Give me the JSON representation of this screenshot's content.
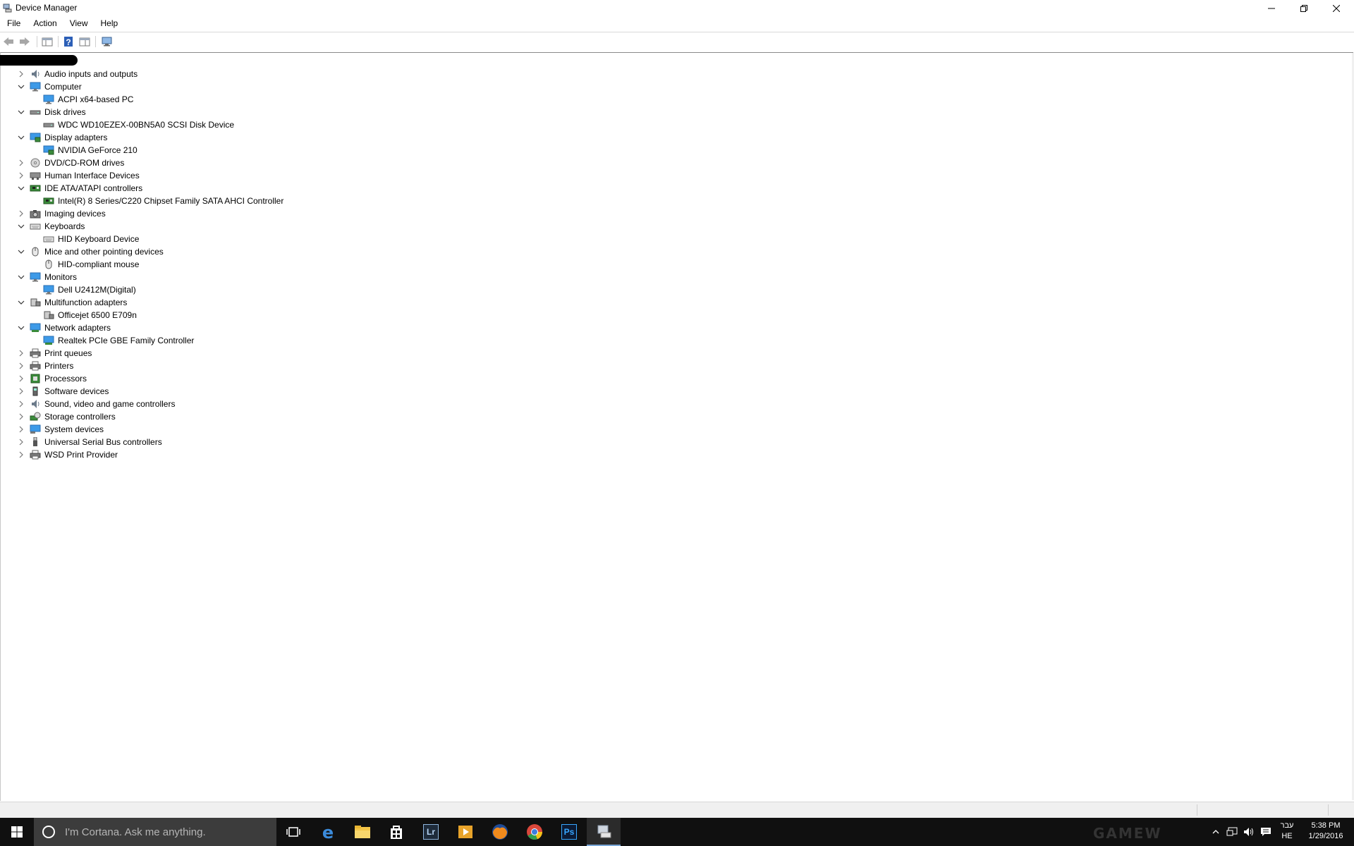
{
  "window": {
    "title": "Device Manager"
  },
  "menu": [
    "File",
    "Action",
    "View",
    "Help"
  ],
  "tree": [
    {
      "label": "Audio inputs and outputs",
      "expanded": false,
      "icon": "speaker-icon",
      "children": []
    },
    {
      "label": "Computer",
      "expanded": true,
      "icon": "monitor-icon",
      "children": [
        {
          "label": "ACPI x64-based PC",
          "icon": "monitor-icon"
        }
      ]
    },
    {
      "label": "Disk drives",
      "expanded": true,
      "icon": "disk-drive-icon",
      "children": [
        {
          "label": "WDC WD10EZEX-00BN5A0 SCSI Disk Device",
          "icon": "disk-drive-icon"
        }
      ]
    },
    {
      "label": "Display adapters",
      "expanded": true,
      "icon": "display-adapter-icon",
      "children": [
        {
          "label": "NVIDIA GeForce 210",
          "icon": "display-adapter-icon"
        }
      ]
    },
    {
      "label": "DVD/CD-ROM drives",
      "expanded": false,
      "icon": "dvd-icon",
      "children": []
    },
    {
      "label": "Human Interface Devices",
      "expanded": false,
      "icon": "hid-icon",
      "children": []
    },
    {
      "label": "IDE ATA/ATAPI controllers",
      "expanded": true,
      "icon": "controller-card-icon",
      "children": [
        {
          "label": "Intel(R) 8 Series/C220 Chipset Family SATA AHCI Controller",
          "icon": "controller-card-icon"
        }
      ]
    },
    {
      "label": "Imaging devices",
      "expanded": false,
      "icon": "camera-icon",
      "children": []
    },
    {
      "label": "Keyboards",
      "expanded": true,
      "icon": "keyboard-icon",
      "children": [
        {
          "label": "HID Keyboard Device",
          "icon": "keyboard-icon"
        }
      ]
    },
    {
      "label": "Mice and other pointing devices",
      "expanded": true,
      "icon": "mouse-icon",
      "children": [
        {
          "label": "HID-compliant mouse",
          "icon": "mouse-icon"
        }
      ]
    },
    {
      "label": "Monitors",
      "expanded": true,
      "icon": "monitor-icon",
      "children": [
        {
          "label": "Dell U2412M(Digital)",
          "icon": "monitor-icon"
        }
      ]
    },
    {
      "label": "Multifunction adapters",
      "expanded": true,
      "icon": "multifunction-icon",
      "children": [
        {
          "label": "Officejet 6500 E709n",
          "icon": "multifunction-icon"
        }
      ]
    },
    {
      "label": "Network adapters",
      "expanded": true,
      "icon": "network-adapter-icon",
      "children": [
        {
          "label": "Realtek PCIe GBE Family Controller",
          "icon": "network-adapter-icon"
        }
      ]
    },
    {
      "label": "Print queues",
      "expanded": false,
      "icon": "printer-icon",
      "children": []
    },
    {
      "label": "Printers",
      "expanded": false,
      "icon": "printer-icon",
      "children": []
    },
    {
      "label": "Processors",
      "expanded": false,
      "icon": "processor-icon",
      "children": []
    },
    {
      "label": "Software devices",
      "expanded": false,
      "icon": "software-device-icon",
      "children": []
    },
    {
      "label": "Sound, video and game controllers",
      "expanded": false,
      "icon": "speaker-icon",
      "children": []
    },
    {
      "label": "Storage controllers",
      "expanded": false,
      "icon": "storage-controller-icon",
      "children": []
    },
    {
      "label": "System devices",
      "expanded": false,
      "icon": "system-devices-icon",
      "children": []
    },
    {
      "label": "Universal Serial Bus controllers",
      "expanded": false,
      "icon": "usb-icon",
      "children": []
    },
    {
      "label": "WSD Print Provider",
      "expanded": false,
      "icon": "printer-icon",
      "children": []
    }
  ],
  "taskbar": {
    "search_placeholder": "I'm Cortana. Ask me anything.",
    "apps": [
      "task-view-icon",
      "edge-icon",
      "file-explorer-icon",
      "store-icon",
      "lightroom-icon",
      "media-player-icon",
      "firefox-icon",
      "chrome-icon",
      "photoshop-icon",
      "device-manager-icon"
    ],
    "lightroom_label": "Lr",
    "photoshop_label": "Ps",
    "lang_top": "עבר",
    "lang_bottom": "HE",
    "time": "5:38 PM",
    "date": "1/29/2016",
    "watermark": "GAMEW"
  },
  "colors": {
    "accent": "#7aa7d8",
    "taskbar": "#101010",
    "search_box": "#3c3c3c"
  }
}
